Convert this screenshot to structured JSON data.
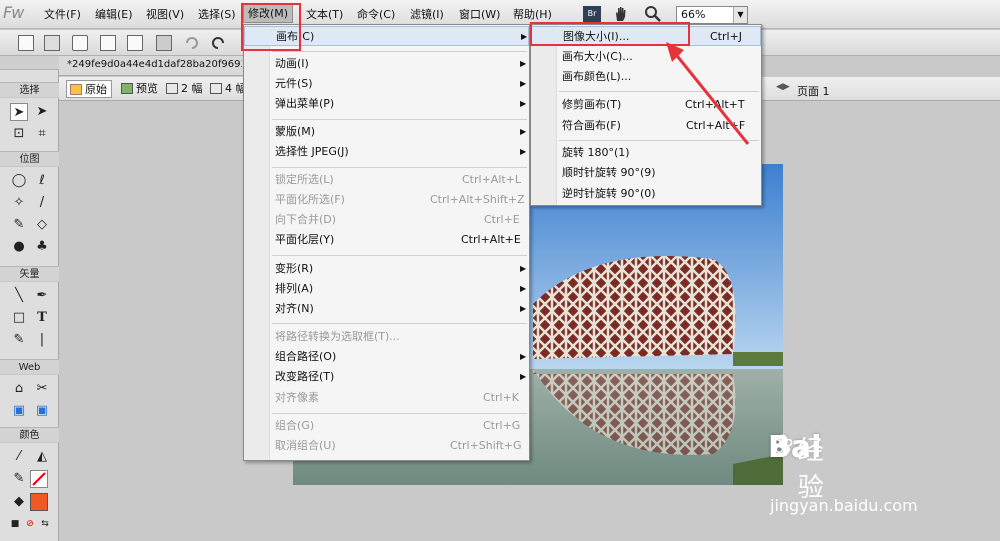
{
  "app": {
    "logo": "Fw"
  },
  "menubar": {
    "items": [
      {
        "label": "文件(F)"
      },
      {
        "label": "编辑(E)"
      },
      {
        "label": "视图(V)"
      },
      {
        "label": "选择(S)"
      },
      {
        "label": "修改(M)"
      },
      {
        "label": "文本(T)"
      },
      {
        "label": "命令(C)"
      },
      {
        "label": "滤镜(I)"
      },
      {
        "label": "窗口(W)"
      },
      {
        "label": "帮助(H)"
      }
    ],
    "br_badge": "Br",
    "zoom_value": "66%"
  },
  "document": {
    "tab_title": "*249fe9d0a44e4d1daf28ba20f96930f"
  },
  "viewbar": {
    "original": "原始",
    "preview": "预览",
    "two_up": "2 幅",
    "four_up": "4 幅",
    "page": "页面 1"
  },
  "tools": {
    "select": "选择",
    "bitmap": "位图",
    "vector": "矢量",
    "web": "Web",
    "colors": "颜色"
  },
  "modify_menu": {
    "items": [
      {
        "label": "画布(C)",
        "shortcut": "",
        "submenu": true
      },
      {
        "label": "动画(I)",
        "shortcut": "",
        "submenu": true
      },
      {
        "label": "元件(S)",
        "shortcut": "",
        "submenu": true
      },
      {
        "label": "弹出菜单(P)",
        "shortcut": "",
        "submenu": true
      },
      {
        "label": "蒙版(M)",
        "shortcut": "",
        "submenu": true
      },
      {
        "label": "选择性 JPEG(J)",
        "shortcut": "",
        "submenu": true
      },
      {
        "label": "锁定所选(L)",
        "shortcut": "Ctrl+Alt+L",
        "disabled": true
      },
      {
        "label": "平面化所选(F)",
        "shortcut": "Ctrl+Alt+Shift+Z",
        "disabled": true
      },
      {
        "label": "向下合并(D)",
        "shortcut": "Ctrl+E",
        "disabled": true
      },
      {
        "label": "平面化层(Y)",
        "shortcut": "Ctrl+Alt+E"
      },
      {
        "label": "变形(R)",
        "shortcut": "",
        "submenu": true
      },
      {
        "label": "排列(A)",
        "shortcut": "",
        "submenu": true
      },
      {
        "label": "对齐(N)",
        "shortcut": "",
        "submenu": true
      },
      {
        "label": "将路径转换为选取框(T)...",
        "shortcut": "",
        "disabled": true
      },
      {
        "label": "组合路径(O)",
        "shortcut": "",
        "submenu": true
      },
      {
        "label": "改变路径(T)",
        "shortcut": "",
        "submenu": true
      },
      {
        "label": "对齐像素",
        "shortcut": "Ctrl+K",
        "disabled": true
      },
      {
        "label": "组合(G)",
        "shortcut": "Ctrl+G",
        "disabled": true
      },
      {
        "label": "取消组合(U)",
        "shortcut": "Ctrl+Shift+G",
        "disabled": true
      }
    ]
  },
  "canvas_submenu": {
    "items": [
      {
        "label": "图像大小(I)...",
        "shortcut": "Ctrl+J"
      },
      {
        "label": "画布大小(C)...",
        "shortcut": ""
      },
      {
        "label": "画布颜色(L)...",
        "shortcut": ""
      },
      {
        "label": "修剪画布(T)",
        "shortcut": "Ctrl+Alt+T"
      },
      {
        "label": "符合画布(F)",
        "shortcut": "Ctrl+Alt+F"
      },
      {
        "label": "旋转 180°(1)",
        "shortcut": ""
      },
      {
        "label": "顺时针旋转 90°(9)",
        "shortcut": ""
      },
      {
        "label": "逆时针旋转 90°(0)",
        "shortcut": ""
      }
    ]
  },
  "watermark": {
    "brand": "Bai",
    "brand2": "经验",
    "url": "jingyan.baidu.com"
  },
  "colors": {
    "highlight_box": "#e8323a",
    "menu_bg": "#f5f5f5",
    "stroke_color": "#f05a22"
  }
}
